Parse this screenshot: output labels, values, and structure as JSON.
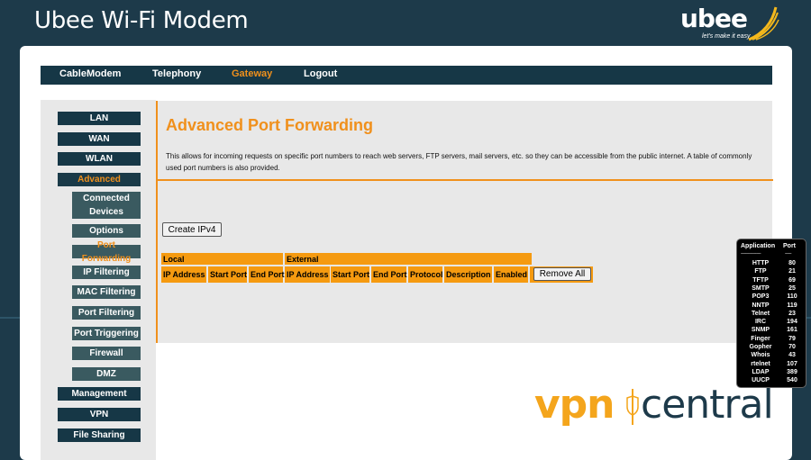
{
  "app_title": "Ubee Wi-Fi Modem",
  "logo": {
    "brand": "ubee",
    "tagline": "let's make it easy"
  },
  "top_nav": [
    {
      "label": "CableModem"
    },
    {
      "label": "Telephony"
    },
    {
      "label": "Gateway",
      "active": true
    },
    {
      "label": "Logout"
    }
  ],
  "sidebar": {
    "items": [
      {
        "label": "LAN"
      },
      {
        "label": "WAN"
      },
      {
        "label": "WLAN"
      },
      {
        "label": "Advanced",
        "active": true
      },
      {
        "label": "Connected Devices",
        "sub": true
      },
      {
        "label": "Options",
        "sub": true
      },
      {
        "label": "Port Forwarding",
        "sub": true,
        "active": true
      },
      {
        "label": "IP Filtering",
        "sub": true
      },
      {
        "label": "MAC Filtering",
        "sub": true
      },
      {
        "label": "Port Filtering",
        "sub": true
      },
      {
        "label": "Port Triggering",
        "sub": true
      },
      {
        "label": "Firewall",
        "sub": true
      },
      {
        "label": "DMZ",
        "sub": true
      },
      {
        "label": "Management"
      },
      {
        "label": "VPN"
      },
      {
        "label": "File Sharing"
      }
    ]
  },
  "main": {
    "title": "Advanced Port Forwarding",
    "description": "This allows for incoming requests on specific port numbers to reach web servers, FTP servers, mail servers, etc. so they can be accessible from the public internet. A table of commonly used port numbers is also provided.",
    "create_button": "Create IPv4",
    "table": {
      "group_local": "Local",
      "group_external": "External",
      "columns": [
        "IP Address",
        "Start Port",
        "End Port",
        "IP Address",
        "Start Port",
        "End Port",
        "Protocol",
        "Description",
        "Enabled"
      ],
      "remove_all": "Remove All"
    }
  },
  "port_reference": {
    "header_app": "Application",
    "header_port": "Port",
    "dash_app": "-------------------",
    "dash_port": "------",
    "rows": [
      {
        "app": "HTTP",
        "port": "80"
      },
      {
        "app": "FTP",
        "port": "21"
      },
      {
        "app": "TFTP",
        "port": "69"
      },
      {
        "app": "SMTP",
        "port": "25"
      },
      {
        "app": "POP3",
        "port": "110"
      },
      {
        "app": "NNTP",
        "port": "119"
      },
      {
        "app": "Telnet",
        "port": "23"
      },
      {
        "app": "IRC",
        "port": "194"
      },
      {
        "app": "SNMP",
        "port": "161"
      },
      {
        "app": "Finger",
        "port": "79"
      },
      {
        "app": "Gopher",
        "port": "70"
      },
      {
        "app": "Whois",
        "port": "43"
      },
      {
        "app": "rtelnet",
        "port": "107"
      },
      {
        "app": "LDAP",
        "port": "389"
      },
      {
        "app": "UUCP",
        "port": "540"
      }
    ]
  },
  "watermark": {
    "part1": "vpn",
    "part2": "central"
  },
  "colors": {
    "accent": "#f0901c",
    "navy": "#163746",
    "background": "#1d3a4a",
    "panel": "#e8e8e8"
  }
}
